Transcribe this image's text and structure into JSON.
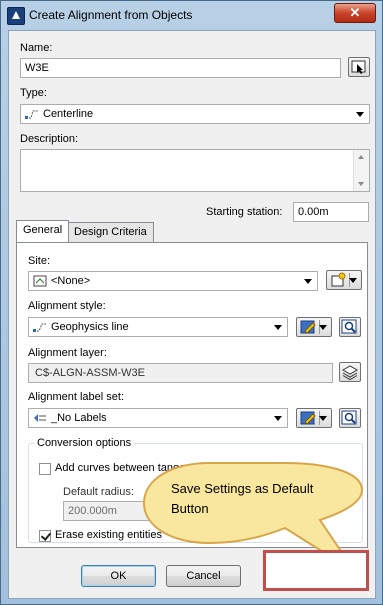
{
  "window": {
    "title": "Create Alignment from Objects",
    "close_label": "✕"
  },
  "name": {
    "label": "Name:",
    "value": "W3E"
  },
  "type": {
    "label": "Type:",
    "value": "Centerline"
  },
  "description": {
    "label": "Description:",
    "value": ""
  },
  "starting_station": {
    "label": "Starting station:",
    "value": "0.00m"
  },
  "tabs": [
    {
      "label": "General"
    },
    {
      "label": "Design Criteria"
    }
  ],
  "site": {
    "label": "Site:",
    "value": "<None>"
  },
  "alignment_style": {
    "label": "Alignment style:",
    "value": "Geophysics line"
  },
  "alignment_layer": {
    "label": "Alignment layer:",
    "value": "C$-ALGN-ASSM-W3E"
  },
  "alignment_label_set": {
    "label": "Alignment label set:",
    "value": "_No Labels"
  },
  "conversion": {
    "title": "Conversion options",
    "add_curves_label": "Add curves between tangents",
    "add_curves_checked": false,
    "default_radius_label": "Default radius:",
    "default_radius_value": "200.000m",
    "erase_label": "Erase existing entities",
    "erase_checked": true
  },
  "buttons": {
    "ok": "OK",
    "cancel": "Cancel"
  },
  "callout": {
    "text_line1": "Save Settings as Default",
    "text_line2": "Button",
    "fill": "#f9e79f",
    "stroke": "#d9a54a"
  },
  "highlight_color": "#c0504d"
}
